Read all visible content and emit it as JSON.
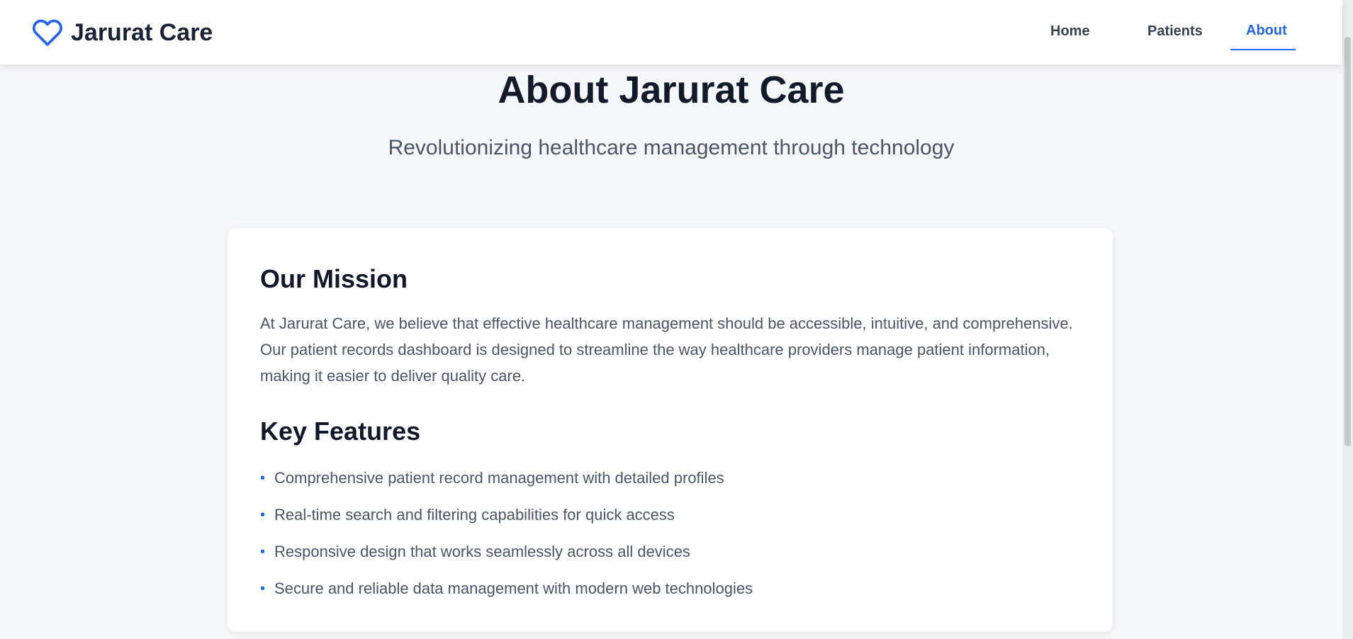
{
  "header": {
    "brand_name": "Jarurat Care",
    "brand_icon": "heart-icon",
    "brand_color": "#2563eb",
    "nav": [
      {
        "label": "Home",
        "active": false
      },
      {
        "label": "Patients",
        "active": false
      },
      {
        "label": "About",
        "active": true
      }
    ]
  },
  "page": {
    "title": "About Jarurat Care",
    "subtitle": "Revolutionizing healthcare management through technology"
  },
  "mission": {
    "heading": "Our Mission",
    "text": "At Jarurat Care, we believe that effective healthcare management should be accessible, intuitive, and comprehensive. Our patient records dashboard is designed to streamline the way healthcare providers manage patient information, making it easier to deliver quality care."
  },
  "features": {
    "heading": "Key Features",
    "bullet": "•",
    "items": [
      "Comprehensive patient record management with detailed profiles",
      "Real-time search and filtering capabilities for quick access",
      "Responsive design that works seamlessly across all devices",
      "Secure and reliable data management with modern web technologies"
    ]
  },
  "colors": {
    "accent": "#2563eb",
    "background": "#f6f7f9",
    "card": "#ffffff",
    "heading": "#111827",
    "body_text": "#4b5563"
  }
}
